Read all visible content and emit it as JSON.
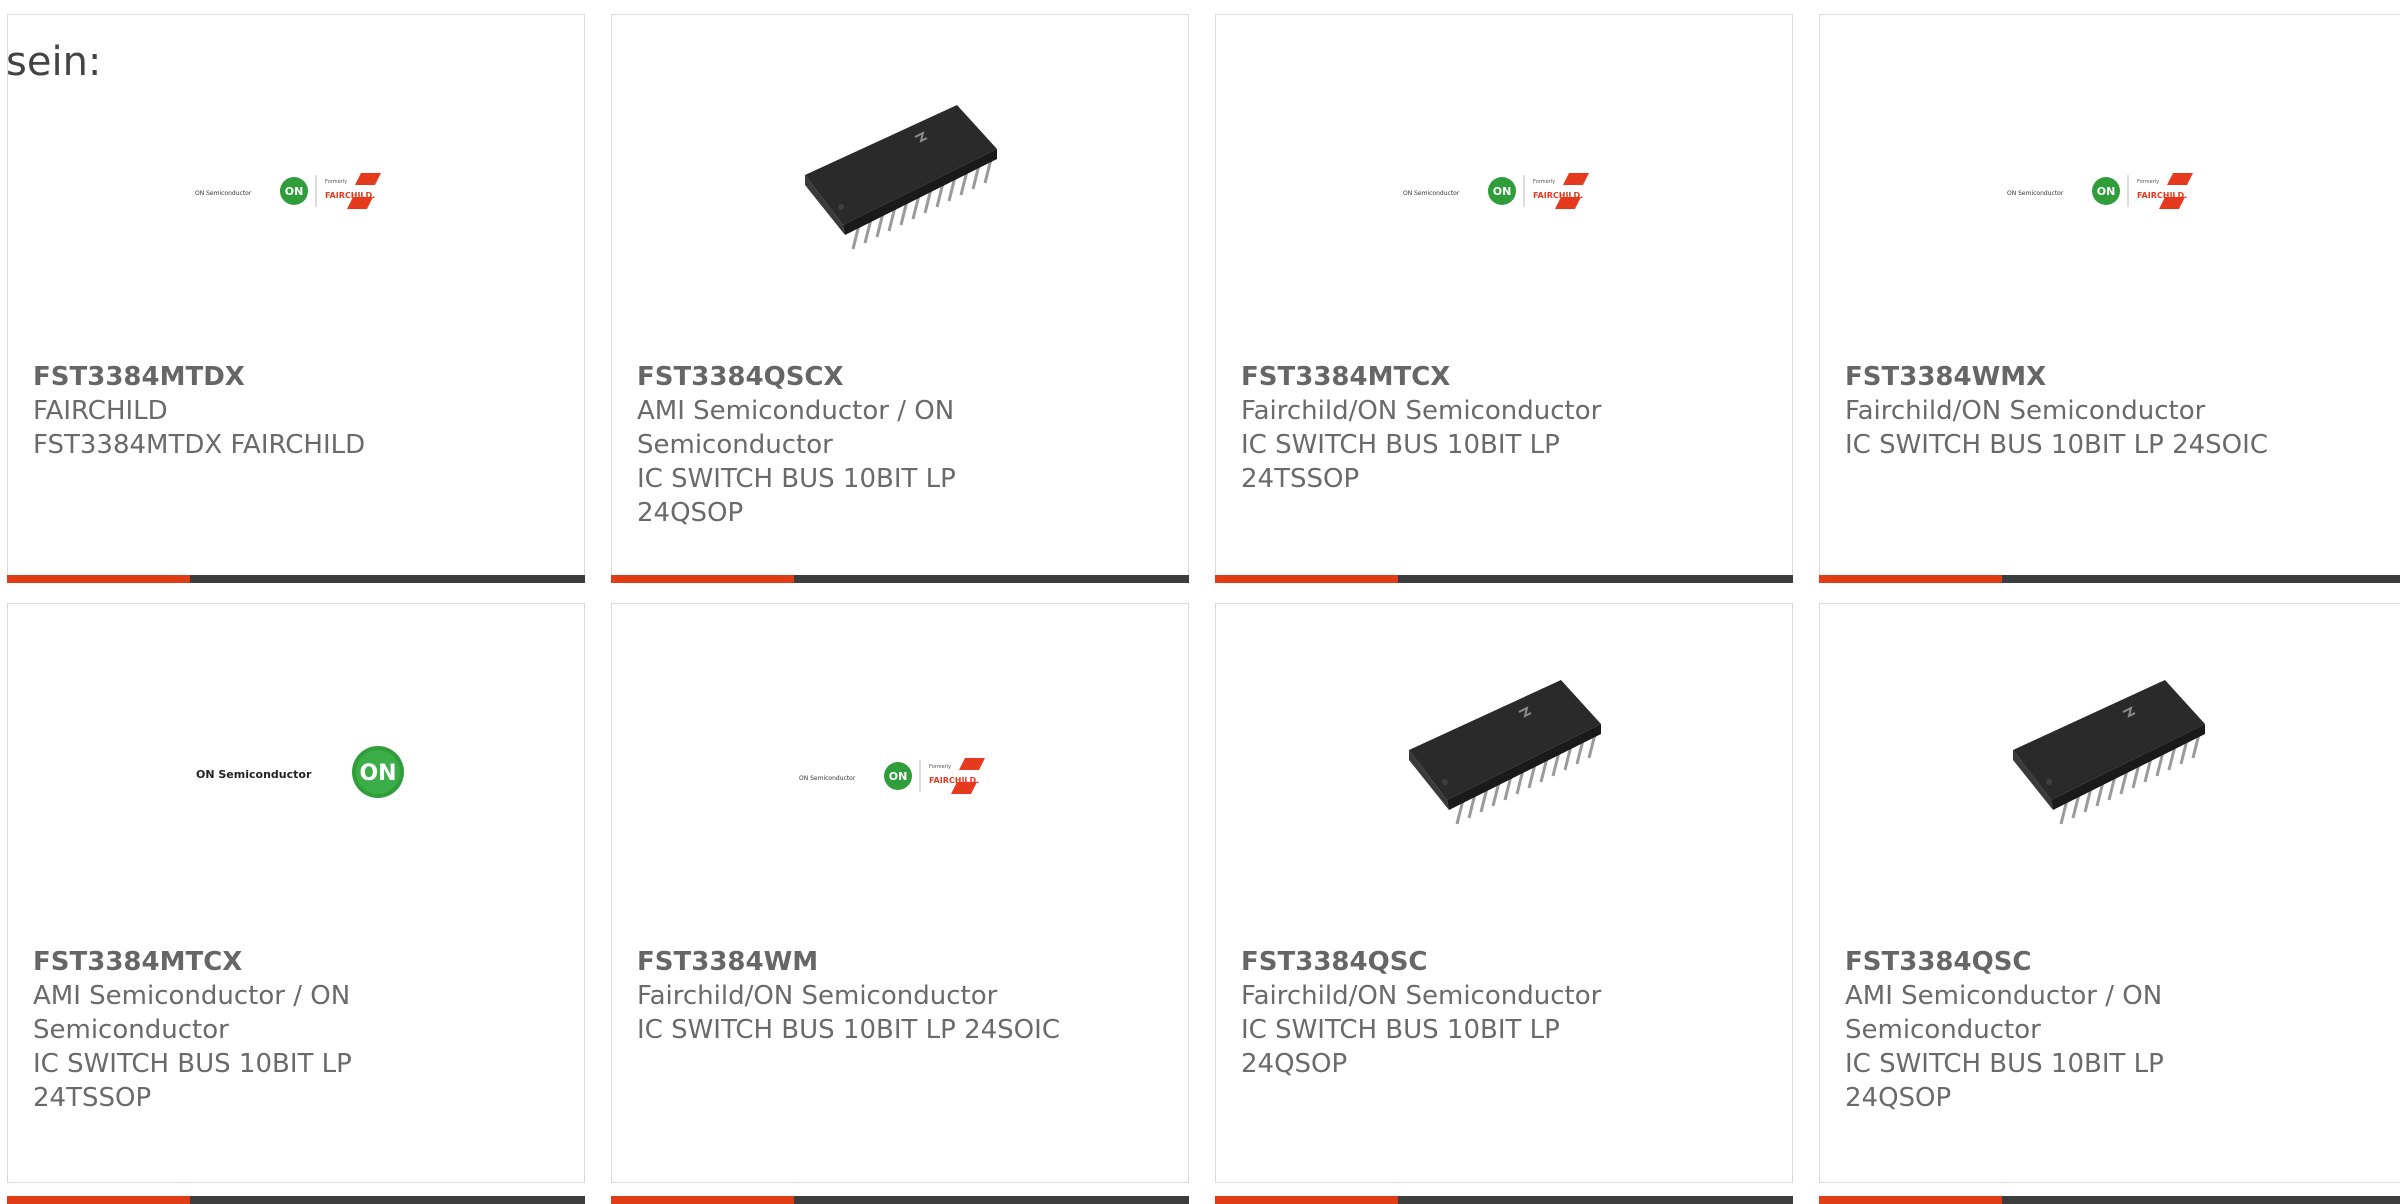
{
  "lead_text": "sein:",
  "colors": {
    "accent": "#e03c16",
    "bar": "#3d3d3d",
    "on_green": "#2e9d3a",
    "fairchild_red": "#e63a1e"
  },
  "logos": {
    "on_small": "ON Semiconductor",
    "formerly": "Formerly",
    "fairchild": "FAIRCHILD.",
    "on_big": "ON Semiconductor",
    "on_mark": "ON"
  },
  "products": [
    {
      "part": "FST3384MTDX",
      "lines": [
        "FAIRCHILD",
        "FST3384MTDX FAIRCHILD"
      ],
      "image": "on-fairchild-logo"
    },
    {
      "part": "FST3384QSCX",
      "lines": [
        "AMI Semiconductor / ON",
        "Semiconductor",
        "IC SWITCH BUS 10BIT LP",
        "24QSOP"
      ],
      "image": "chip-photo"
    },
    {
      "part": "FST3384MTCX",
      "lines": [
        "Fairchild/ON Semiconductor",
        "IC SWITCH BUS 10BIT LP",
        "24TSSOP"
      ],
      "image": "on-fairchild-logo"
    },
    {
      "part": "FST3384WMX",
      "lines": [
        "Fairchild/ON Semiconductor",
        "IC SWITCH BUS 10BIT LP 24SOIC"
      ],
      "image": "on-fairchild-logo"
    },
    {
      "part": "FST3384MTCX",
      "lines": [
        "AMI Semiconductor / ON",
        "Semiconductor",
        "IC SWITCH BUS 10BIT LP",
        "24TSSOP"
      ],
      "image": "on-semiconductor-logo"
    },
    {
      "part": "FST3384WM",
      "lines": [
        "Fairchild/ON Semiconductor",
        "IC SWITCH BUS 10BIT LP 24SOIC"
      ],
      "image": "on-fairchild-logo"
    },
    {
      "part": "FST3384QSC",
      "lines": [
        "Fairchild/ON Semiconductor",
        "IC SWITCH BUS 10BIT LP",
        "24QSOP"
      ],
      "image": "chip-photo"
    },
    {
      "part": "FST3384QSC",
      "lines": [
        "AMI Semiconductor / ON",
        "Semiconductor",
        "IC SWITCH BUS 10BIT LP",
        "24QSOP"
      ],
      "image": "chip-photo"
    }
  ]
}
